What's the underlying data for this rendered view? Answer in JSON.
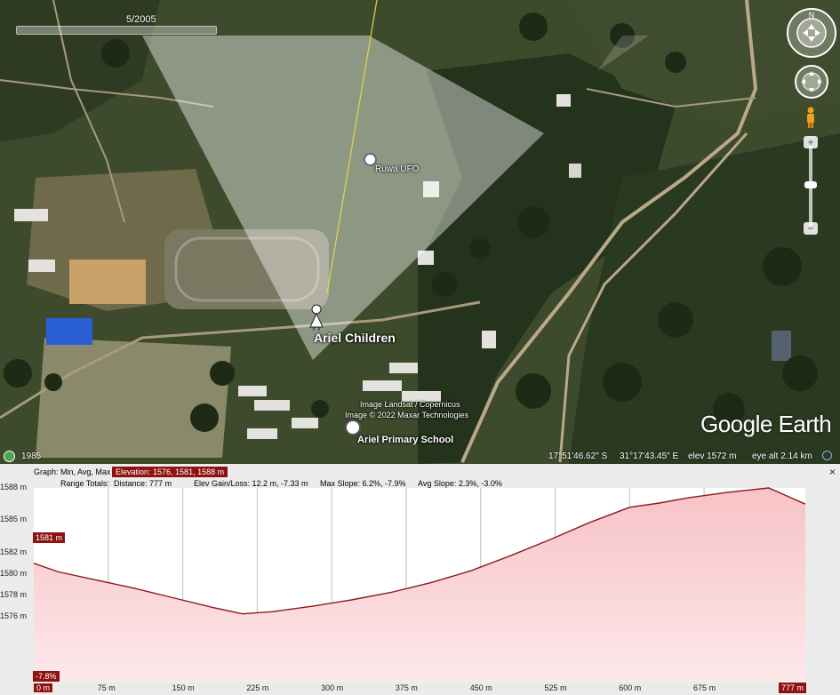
{
  "timeline": {
    "date": "5/2005",
    "start_year": "1985"
  },
  "map": {
    "placemarks": {
      "ufo": "Ruwa UFO",
      "children": "Ariel Children",
      "school": "Ariel Primary School"
    },
    "attribution": {
      "line1": "Image Landsat / Copernicus",
      "line2": "Image © 2022 Maxar Technologies"
    },
    "logo": "Google Earth"
  },
  "status_bar": {
    "latitude": "17°51'46.62\" S",
    "longitude": "31°17'43.45\" E",
    "elevation": "elev  1572 m",
    "eye_alt": "eye alt  2.14 km"
  },
  "profile": {
    "graph_label": "Graph: Min, Avg, Max",
    "elevation_summary": "Elevation: 1576, 1581, 1588 m",
    "range_totals_label": "Range Totals:",
    "distance": "Distance: 777 m",
    "elev_gain_loss": "Elev Gain/Loss: 12.2 m, -7.33 m",
    "max_slope": "Max Slope: 6.2%, -7.9%",
    "avg_slope": "Avg Slope: 2.3%, -3.0%",
    "cursor_elevation": "1581 m",
    "cursor_slope": "-7.8%",
    "end_distance": "777 m",
    "close": "×"
  },
  "chart_data": {
    "type": "area",
    "xlabel": "",
    "ylabel": "",
    "x_ticks": [
      "0 m",
      "75 m",
      "150 m",
      "225 m",
      "300 m",
      "375 m",
      "450 m",
      "525 m",
      "600 m",
      "675 m",
      "777 m"
    ],
    "y_ticks": [
      "1588 m",
      "1585 m",
      "1582 m",
      "1580 m",
      "1578 m",
      "1576 m"
    ],
    "ylim": [
      1570,
      1588
    ],
    "xlim": [
      0,
      777
    ],
    "series": [
      {
        "x": [
          0,
          25,
          60,
          100,
          140,
          180,
          210,
          240,
          280,
          320,
          360,
          400,
          440,
          480,
          520,
          560,
          600,
          630,
          660,
          700,
          740,
          777
        ],
        "y": [
          1581,
          1580.2,
          1579.5,
          1578.7,
          1577.8,
          1576.9,
          1576.3,
          1576.5,
          1577.0,
          1577.6,
          1578.3,
          1579.2,
          1580.3,
          1581.7,
          1583.2,
          1584.8,
          1586.2,
          1586.6,
          1587.1,
          1587.6,
          1588.0,
          1586.5
        ]
      }
    ],
    "colors": {
      "line": "#8b1a1a",
      "fill_top": "#f7c2c6",
      "fill_bottom": "#fde8ea"
    },
    "grid": true
  }
}
